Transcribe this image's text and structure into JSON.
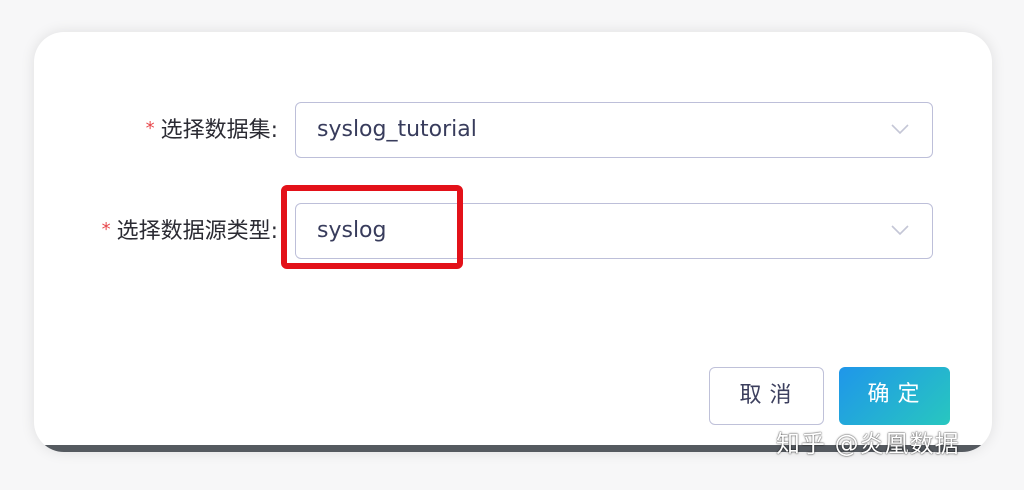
{
  "form": {
    "dataset": {
      "required_mark": "*",
      "label": "选择数据集:",
      "value": "syslog_tutorial"
    },
    "source_type": {
      "required_mark": "*",
      "label": "选择数据源类型:",
      "value": "syslog"
    }
  },
  "buttons": {
    "cancel_label": "取消",
    "confirm_label": "确定"
  },
  "watermark": {
    "text": "知乎 @炎凰数据"
  },
  "colors": {
    "required": "#e8474b",
    "highlight": "#e31119",
    "confirm_gradient_start": "#1f96ea",
    "confirm_gradient_end": "#28c7bf"
  },
  "icons": {
    "select_arrow": "chevron-down-icon"
  }
}
